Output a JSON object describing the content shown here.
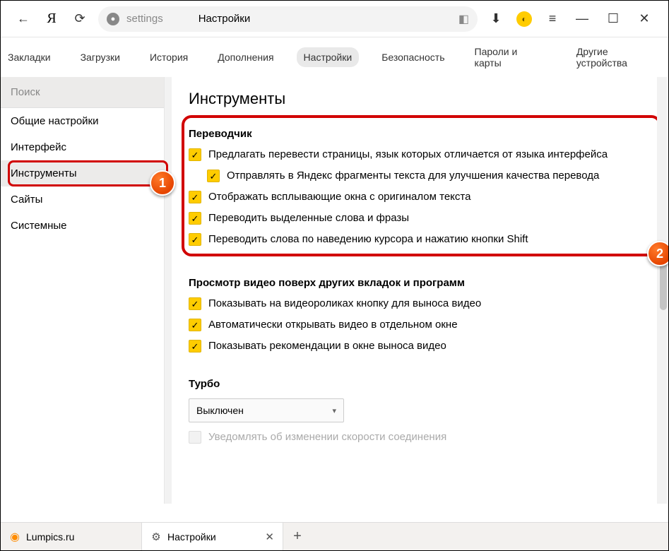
{
  "toolbar": {
    "address_host": "settings",
    "address_title": "Настройки"
  },
  "nav": {
    "items": [
      "Закладки",
      "Загрузки",
      "История",
      "Дополнения",
      "Настройки",
      "Безопасность",
      "Пароли и карты",
      "Другие устройства"
    ],
    "active_index": 4
  },
  "sidebar": {
    "search_placeholder": "Поиск",
    "items": [
      "Общие настройки",
      "Интерфейс",
      "Инструменты",
      "Сайты",
      "Системные"
    ],
    "active_index": 2
  },
  "callouts": {
    "one": "1",
    "two": "2"
  },
  "content": {
    "heading": "Инструменты",
    "translator": {
      "title": "Переводчик",
      "opts": [
        {
          "label": "Предлагать перевести страницы, язык которых отличается от языка интерфейса",
          "checked": true,
          "indent": false
        },
        {
          "label": "Отправлять в Яндекс фрагменты текста для улучшения качества перевода",
          "checked": true,
          "indent": true
        },
        {
          "label": "Отображать всплывающие окна с оригиналом текста",
          "checked": true,
          "indent": false
        },
        {
          "label": "Переводить выделенные слова и фразы",
          "checked": true,
          "indent": false
        },
        {
          "label": "Переводить слова по наведению курсора и нажатию кнопки Shift",
          "checked": true,
          "indent": false
        }
      ]
    },
    "video": {
      "title": "Просмотр видео поверх других вкладок и программ",
      "opts": [
        {
          "label": "Показывать на видеороликах кнопку для выноса видео",
          "checked": true
        },
        {
          "label": "Автоматически открывать видео в отдельном окне",
          "checked": true
        },
        {
          "label": "Показывать рекомендации в окне выноса видео",
          "checked": true
        }
      ]
    },
    "turbo": {
      "title": "Турбо",
      "select_value": "Выключен",
      "notify_label": "Уведомлять об изменении скорости соединения"
    }
  },
  "tabs": {
    "items": [
      {
        "label": "Lumpics.ru",
        "icon": "orange"
      },
      {
        "label": "Настройки",
        "icon": "gear",
        "active": true
      }
    ]
  }
}
